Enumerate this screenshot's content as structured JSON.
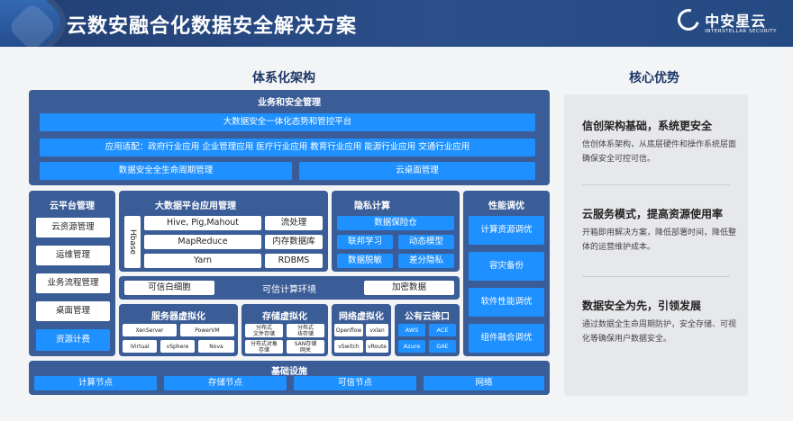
{
  "banner": {
    "title": "云数安融合化数据安全解决方案",
    "brand_name": "中安星云",
    "brand_en": "INTERSTELLAR SECURITY"
  },
  "headings": {
    "left": "体系化架构",
    "right": "核心优势"
  },
  "business": {
    "title": "业务和安全管理",
    "platform": "大数据安全一体化态势和管控平台",
    "apps": "应用适配：政府行业应用  企业管理应用  医疗行业应用  教育行业应用  能源行业应用  交通行业应用",
    "lifecycle": "数据安全全生命周期管理",
    "desktop": "云桌面管理"
  },
  "cloud_mgmt": {
    "title": "云平台管理",
    "items": [
      "云资源管理",
      "运维管理",
      "业务流程管理",
      "桌面管理"
    ],
    "highlight": "资源计费"
  },
  "bigdata": {
    "title": "大数据平台应用管理",
    "hbase": "Hbase",
    "left": [
      "Hive, Pig,Mahout",
      "MapReduce",
      "Yarn"
    ],
    "right": [
      "流处理",
      "内存数据库",
      "RDBMS"
    ]
  },
  "privacy": {
    "title": "隐私计算",
    "main": "数据保险仓",
    "grid": [
      "联邦学习",
      "动态模型",
      "数据脱敏",
      "差分隐私"
    ]
  },
  "trusted": {
    "left": "可信白细胞",
    "center": "可信计算环境",
    "right": "加密数据"
  },
  "perf": {
    "title": "性能调优",
    "items": [
      "计算资源调优",
      "容灾备份",
      "软件性能调优",
      "组件融合调优"
    ]
  },
  "server_virt": {
    "title": "服务器虚拟化",
    "items": [
      "XenServer",
      "PowerVM",
      "iVirtual",
      "vSphere",
      "Nova"
    ]
  },
  "storage_virt": {
    "title": "存储虚拟化",
    "items": [
      "分布式\n文件存储",
      "分布式\n块存储",
      "分布式对象\n存储",
      "SAN存储\n网关"
    ]
  },
  "net_virt": {
    "title": "网络虚拟化",
    "items": [
      "Openflow",
      "vxlan",
      "vSwitch",
      "vRoute"
    ]
  },
  "public_cloud": {
    "title": "公有云接口",
    "items": [
      "AWS",
      "ACE",
      "Azure",
      "GAE"
    ]
  },
  "infra": {
    "title": "基础设施",
    "items": [
      "计算节点",
      "存储节点",
      "可信节点",
      "网络"
    ]
  },
  "core": [
    {
      "head": "信创架构基础，系统更安全",
      "desc": "信创体系架构，从底层硬件和操作系统层面确保安全可控可信。"
    },
    {
      "head": "云服务模式，提高资源使用率",
      "desc": "开箱即用解决方案，降低部署时间，降低整体的运营维护成本。"
    },
    {
      "head": "数据安全为先，引领发展",
      "desc": "通过数据全生命周期防护，安全存储、可视化等确保用户数据安全。"
    }
  ]
}
